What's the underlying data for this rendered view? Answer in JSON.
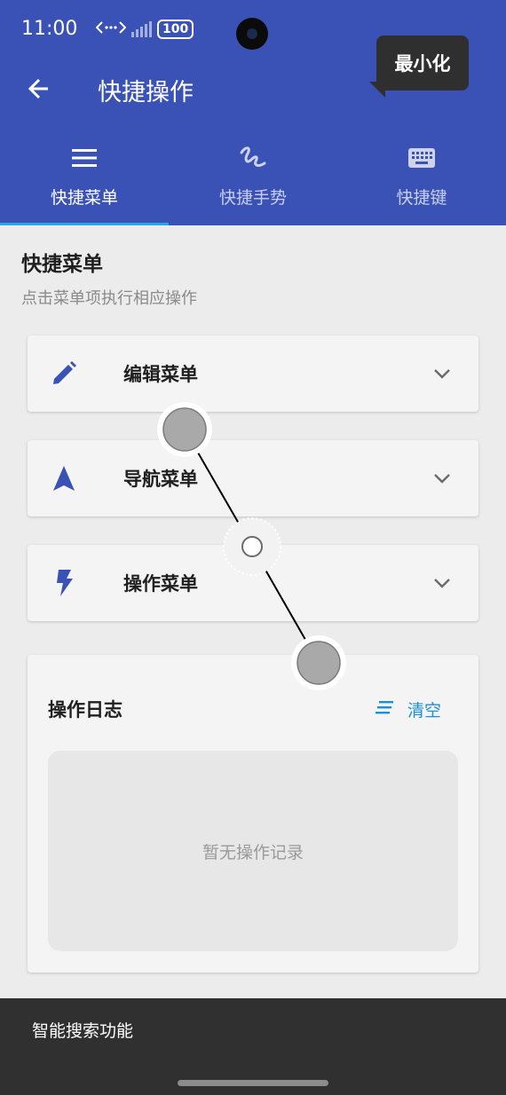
{
  "status_bar": {
    "time": "11:00",
    "network_icon": "data-transfer-icon",
    "battery": "100"
  },
  "header": {
    "title": "快捷操作",
    "back_icon": "arrow-left-icon",
    "tooltip": "最小化"
  },
  "tabs": [
    {
      "label": "快捷菜单",
      "icon": "menu-icon",
      "active": true
    },
    {
      "label": "快捷手势",
      "icon": "gesture-icon",
      "active": false
    },
    {
      "label": "快捷键",
      "icon": "keyboard-icon",
      "active": false
    }
  ],
  "section": {
    "title": "快捷菜单",
    "subtitle": "点击菜单项执行相应操作"
  },
  "menus": [
    {
      "label": "编辑菜单",
      "icon": "pencil-icon"
    },
    {
      "label": "导航菜单",
      "icon": "navigation-arrow-icon"
    },
    {
      "label": "操作菜单",
      "icon": "lightning-icon"
    }
  ],
  "log": {
    "title": "操作日志",
    "clear_label": "清空",
    "empty_text": "暂无操作记录"
  },
  "bottom_bar": {
    "label": "智能搜索功能"
  },
  "colors": {
    "primary": "#3a51b6",
    "accent": "#1a90d8",
    "indicator": "#28a7e8",
    "icon_blue": "#3a51b6"
  }
}
